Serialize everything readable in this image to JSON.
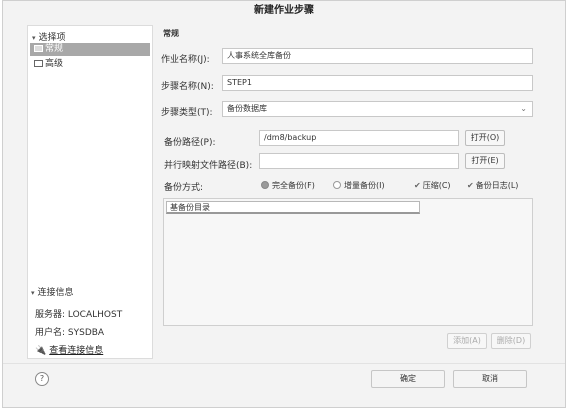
{
  "window": {
    "title": "新建作业步骤"
  },
  "sidebar": {
    "header": "选择项",
    "items": [
      {
        "label": "常规",
        "selected": true
      },
      {
        "label": "高级",
        "selected": false
      }
    ]
  },
  "connection": {
    "header": "连接信息",
    "server": "服务器: LOCALHOST",
    "user": "用户名: SYSDBA",
    "link": "查看连接信息"
  },
  "main": {
    "section_title": "常规",
    "job_name_label": "作业名称(J):",
    "job_name_value": "人事系统全库备份",
    "step_name_label": "步骤名称(N):",
    "step_name_value": "STEP1",
    "step_type_label": "步骤类型(T):",
    "step_type_value": "备份数据库",
    "backup_path_label": "备份路径(P):",
    "backup_path_value": "/dm8/backup",
    "open_p_button": "打开(O)",
    "parallel_label": "并行映射文件路径(B):",
    "parallel_value": "",
    "open_e_button": "打开(E)",
    "method_label": "备份方式:",
    "full_backup": "完全备份(F)",
    "incremental_backup": "增量备份(I)",
    "compress": "压缩(C)",
    "backup_log": "备份日志(L)",
    "dir_table_header": "基备份目录",
    "add_button": "添加(A)",
    "delete_button": "删除(D)"
  },
  "footer": {
    "help": "?",
    "ok_button": "确定",
    "cancel_button": "取消"
  }
}
